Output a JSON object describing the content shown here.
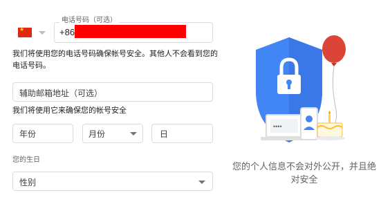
{
  "phone": {
    "country_flag": "china-flag-icon",
    "label": "电话号码（可选）",
    "country_code": "+86",
    "redaction_color": "#ff0000"
  },
  "phone_note": "我们将使用您的电话号码确保帐号安全。其他人不会看到您的电话号码。",
  "recovery_email": {
    "placeholder": "辅助邮箱地址（可选）"
  },
  "email_note": "我们将使用它来确保您的帐号安全",
  "birthday": {
    "year_placeholder": "年份",
    "month_placeholder": "月份",
    "day_placeholder": "日",
    "label": "您的生日"
  },
  "gender": {
    "placeholder": "性别"
  },
  "privacy_text": "您的个人信息不会对外公开，并且绝对安全",
  "colors": {
    "shield": "#4285f4",
    "balloon": "#db4437",
    "border": "#dadce0"
  }
}
